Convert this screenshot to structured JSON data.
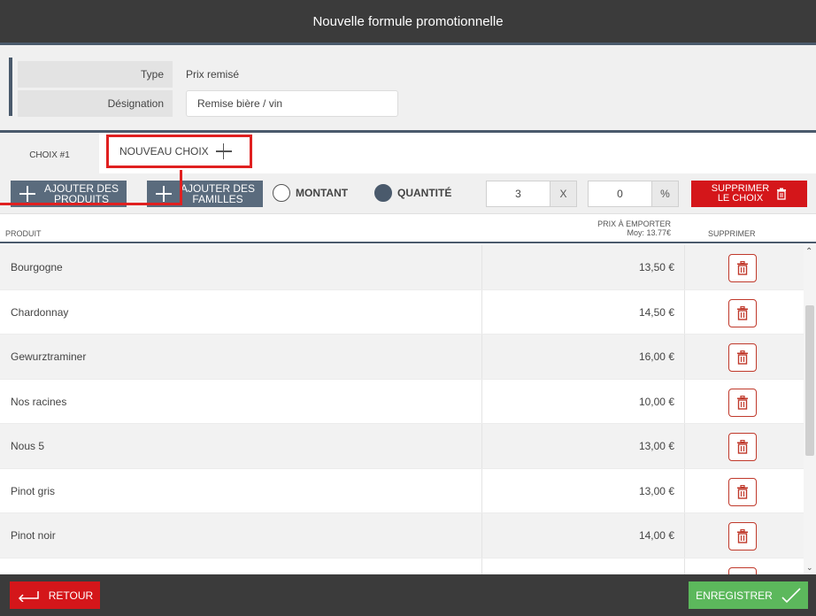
{
  "header": {
    "title": "Nouvelle formule promotionnelle"
  },
  "form": {
    "type_label": "Type",
    "type_value": "Prix remisé",
    "designation_label": "Désignation",
    "designation_value": "Remise bière / vin"
  },
  "tabs": [
    {
      "label": "CHOIX #1"
    },
    {
      "label": "NOUVEAU CHOIX"
    }
  ],
  "toolbar": {
    "add_products_line1": "AJOUTER DES",
    "add_products_line2": "PRODUITS",
    "add_families_line1": "AJOUTER DES",
    "add_families_line2": "FAMILLES",
    "radio_amount": "MONTANT",
    "radio_quantity": "QUANTITÉ",
    "selected_mode": "QUANTITÉ",
    "quantity_value": "3",
    "quantity_unit": "X",
    "percent_value": "0",
    "percent_unit": "%",
    "delete_choice_line1": "SUPPRIMER",
    "delete_choice_line2": "LE CHOIX"
  },
  "table": {
    "col_product": "PRODUIT",
    "col_price_line1": "PRIX À EMPORTER",
    "col_price_line2": "Moy: 13.77€",
    "col_delete": "SUPPRIMER",
    "rows": [
      {
        "name": "Bourgogne",
        "price": "13,50 €"
      },
      {
        "name": "Chardonnay",
        "price": "14,50 €"
      },
      {
        "name": "Gewurztraminer",
        "price": "16,00 €"
      },
      {
        "name": "Nos racines",
        "price": "10,00 €"
      },
      {
        "name": "Nous 5",
        "price": "13,00 €"
      },
      {
        "name": "Pinot gris",
        "price": "13,00 €"
      },
      {
        "name": "Pinot noir",
        "price": "14,00 €"
      },
      {
        "name": "",
        "price": ""
      }
    ]
  },
  "footer": {
    "back_label": "RETOUR",
    "save_label": "ENREGISTRER"
  },
  "icons": {
    "trash": "trash-icon",
    "plus": "plus-icon",
    "back": "arrow-left-icon",
    "check": "check-icon"
  },
  "colors": {
    "dark_bar": "#3b3b3b",
    "slate": "#5a6b7d",
    "danger": "#d4161a",
    "success": "#5cb85c",
    "annotation": "#e02020"
  }
}
